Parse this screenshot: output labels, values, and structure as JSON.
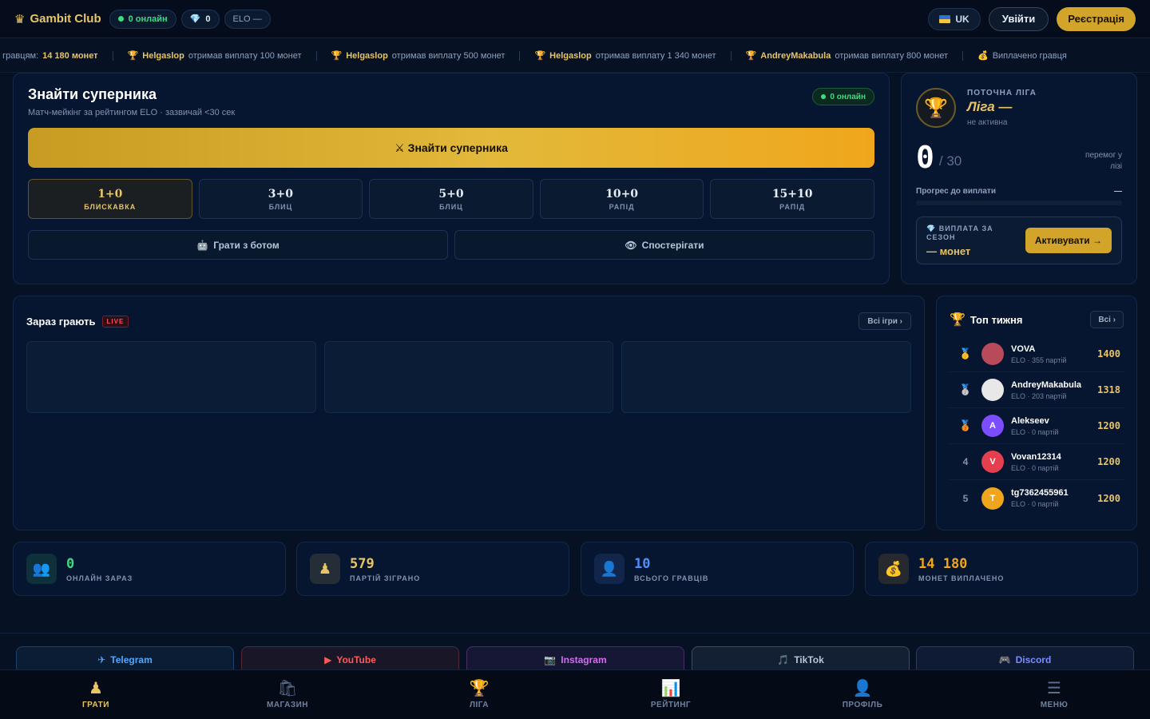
{
  "header": {
    "logo_text": "Gambit Club",
    "online_label": "0 онлайн",
    "gems_count": "0",
    "elo_label": "ELO —",
    "lang_label": "UK",
    "login_label": "Увійти",
    "register_label": "Реєстрація"
  },
  "ticker": {
    "items": [
      {
        "prefix": "о гравцям:",
        "name": "14 180 монет",
        "text": ""
      },
      {
        "prefix": "",
        "name": "Helgaslop",
        "text": "отримав виплату 100 монет"
      },
      {
        "prefix": "",
        "name": "Helgaslop",
        "text": "отримав виплату 500 монет"
      },
      {
        "prefix": "",
        "name": "Helgaslop",
        "text": "отримав виплату 1 340 монет"
      },
      {
        "prefix": "",
        "name": "AndreyMakabula",
        "text": "отримав виплату 800 монет"
      },
      {
        "prefix": "Виплачено гравця",
        "name": "",
        "text": ""
      }
    ]
  },
  "find": {
    "title": "Знайти суперника",
    "subtitle": "Матч-мейкінг за рейтингом ELO · зазвичай <30 сек",
    "online_badge": "0 онлайн",
    "button_label": "Знайти суперника",
    "time_controls": [
      {
        "time": "1+0",
        "name": "БЛИСКАВКА",
        "active": true
      },
      {
        "time": "3+0",
        "name": "БЛИЦ",
        "active": false
      },
      {
        "time": "5+0",
        "name": "БЛИЦ",
        "active": false
      },
      {
        "time": "10+0",
        "name": "РАПІД",
        "active": false
      },
      {
        "time": "15+10",
        "name": "РАПІД",
        "active": false
      }
    ],
    "bot_label": "Грати з ботом",
    "watch_label": "Спостерігати"
  },
  "league": {
    "label": "ПОТОЧНА ЛІГА",
    "name": "Ліга —",
    "status": "не активна",
    "wins": "0",
    "wins_total": "/ 30",
    "wins_label": "перемог у лізі",
    "progress_label": "Прогрес до виплати",
    "progress_value": "—",
    "progress_fraction": 0,
    "payout_label": "ВИПЛАТА ЗА СЕЗОН",
    "payout_value": "— монет",
    "activate_label": "Активувати →"
  },
  "playing": {
    "title": "Зараз грають",
    "live_label": "LIVE",
    "all_games_label": "Всі ігри ›"
  },
  "top_week": {
    "title": "Топ тижня",
    "all_label": "Всі ›",
    "leaders": [
      {
        "rank": "1",
        "medal": true,
        "initial": "",
        "name": "VOVA",
        "meta": "ELO · 355 партій",
        "elo": "1400",
        "avatar_color": "#b84a5a"
      },
      {
        "rank": "2",
        "medal": true,
        "initial": "",
        "name": "AndreyMakabula",
        "meta": "ELO · 203 партій",
        "elo": "1318",
        "avatar_color": "#e8e8e8"
      },
      {
        "rank": "3",
        "medal": true,
        "initial": "A",
        "name": "Alekseev",
        "meta": "ELO · 0 партій",
        "elo": "1200",
        "avatar_color": "#7c4dff"
      },
      {
        "rank": "4",
        "medal": false,
        "initial": "V",
        "name": "Vovan12314",
        "meta": "ELO · 0 партій",
        "elo": "1200",
        "avatar_color": "#e53e4f"
      },
      {
        "rank": "5",
        "medal": false,
        "initial": "T",
        "name": "tg7362455961",
        "meta": "ELO · 0 партій",
        "elo": "1200",
        "avatar_color": "#f0a61c"
      }
    ]
  },
  "stats": [
    {
      "value": "0",
      "label": "ОНЛАЙН ЗАРАЗ",
      "color": "#3ddc84",
      "icon": "users-icon"
    },
    {
      "value": "579",
      "label": "ПАРТІЙ ЗІГРАНО",
      "color": "#e7c567",
      "icon": "pawn-icon"
    },
    {
      "value": "10",
      "label": "ВСЬОГО ГРАВЦІВ",
      "color": "#4f8ff7",
      "icon": "user-icon"
    },
    {
      "value": "14 180",
      "label": "МОНЕТ ВИПЛАЧЕНО",
      "color": "#f0a61c",
      "icon": "money-bag-icon"
    }
  ],
  "socials": [
    {
      "label": "Telegram",
      "color": "#4ea8ff",
      "icon": "telegram-icon"
    },
    {
      "label": "YouTube",
      "color": "#ff5a5a",
      "icon": "youtube-icon"
    },
    {
      "label": "Instagram",
      "color": "#d66bf0",
      "icon": "instagram-icon"
    },
    {
      "label": "TikTok",
      "color": "#b8c6da",
      "icon": "tiktok-icon"
    },
    {
      "label": "Discord",
      "color": "#7b8cff",
      "icon": "discord-icon"
    }
  ],
  "nav": [
    {
      "label": "ГРАТИ",
      "icon": "pawn-icon",
      "active": true
    },
    {
      "label": "МАГАЗИН",
      "icon": "shop-icon",
      "active": false
    },
    {
      "label": "ЛІГА",
      "icon": "trophy-icon",
      "active": false
    },
    {
      "label": "РЕЙТИНГ",
      "icon": "chart-icon",
      "active": false
    },
    {
      "label": "ПРОФІЛЬ",
      "icon": "profile-icon",
      "active": false
    },
    {
      "label": "МЕНЮ",
      "icon": "menu-icon",
      "active": false
    }
  ]
}
